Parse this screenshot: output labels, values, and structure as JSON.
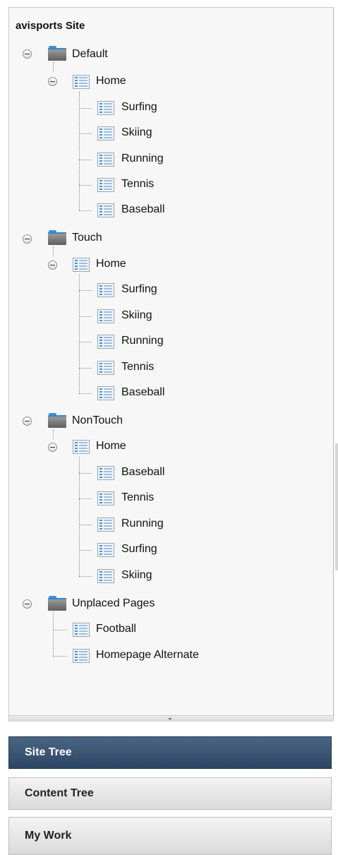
{
  "site_title": "avisports Site",
  "tree": {
    "default": {
      "label": "Default",
      "home": "Home",
      "children": [
        "Surfing",
        "Skiing",
        "Running",
        "Tennis",
        "Baseball"
      ]
    },
    "touch": {
      "label": "Touch",
      "home": "Home",
      "children": [
        "Surfing",
        "Skiing",
        "Running",
        "Tennis",
        "Baseball"
      ]
    },
    "nontouch": {
      "label": "NonTouch",
      "home": "Home",
      "children": [
        "Baseball",
        "Tennis",
        "Running",
        "Surfing",
        "Skiing"
      ]
    },
    "unplaced": {
      "label": "Unplaced Pages",
      "children": [
        "Football",
        "Homepage Alternate"
      ]
    }
  },
  "nav": {
    "site_tree": "Site Tree",
    "content_tree": "Content Tree",
    "my_work": "My Work"
  },
  "colors": {
    "active_tab": "#2d4563",
    "folder_accent": "#3a92d8"
  }
}
